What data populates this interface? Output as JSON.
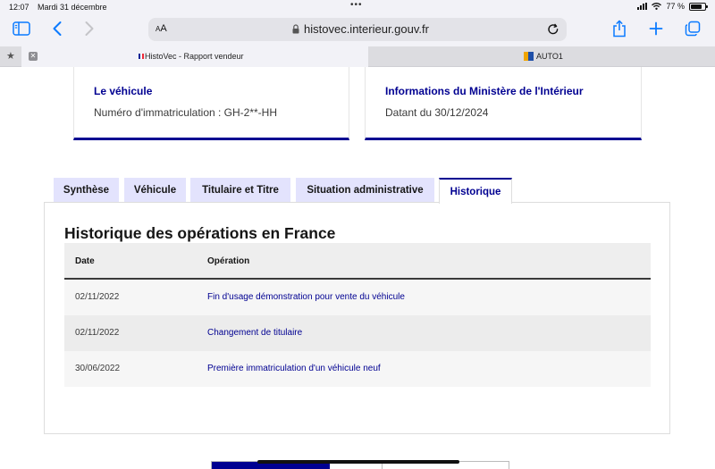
{
  "status_bar": {
    "time": "12:07",
    "date": "Mardi 31 décembre",
    "battery": "77 %",
    "battery_level": 0.77
  },
  "toolbar": {
    "text_size_label": "AA",
    "url": "histovec.interieur.gouv.fr",
    "icons": [
      "sidebar-icon",
      "back-icon",
      "forward-icon",
      "lock-icon",
      "reload-icon",
      "share-icon",
      "new-tab-icon",
      "tabs-overview-icon"
    ]
  },
  "tabs": [
    {
      "title": "HistoVec - Rapport vendeur",
      "active": true
    },
    {
      "title": "AUTO1",
      "active": false
    }
  ],
  "cards": [
    {
      "title": "Le véhicule",
      "text": "Numéro d'immatriculation : GH-2**-HH"
    },
    {
      "title": "Informations du Ministère de l'Intérieur",
      "text": "Datant du 30/12/2024"
    }
  ],
  "section_tabs": [
    "Synthèse",
    "Véhicule",
    "Titulaire et Titre",
    "Situation administrative",
    "Historique"
  ],
  "selected_section_tab": "Historique",
  "history": {
    "title": "Historique des opérations en France",
    "columns": [
      "Date",
      "Opération"
    ],
    "rows": [
      {
        "date": "02/11/2022",
        "operation": "Fin d'usage démonstration pour vente du véhicule"
      },
      {
        "date": "02/11/2022",
        "operation": "Changement de titulaire"
      },
      {
        "date": "30/06/2022",
        "operation": "Première immatriculation d'un véhicule neuf"
      }
    ]
  },
  "colors": {
    "accent": "#000091",
    "tab_background": "#e3e3fd",
    "ios_blue": "#0a7aff"
  }
}
